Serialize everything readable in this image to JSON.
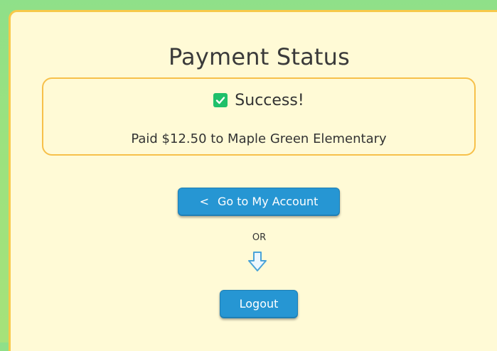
{
  "page": {
    "title": "Payment Status"
  },
  "status": {
    "headline": "Success!",
    "detail": "Paid $12.50 to Maple Green Elementary",
    "icon": "checkbox-check-icon",
    "color": "#1fc06a"
  },
  "actions": {
    "account_chevron": "<",
    "account_label": "Go to My Account",
    "or_text": "OR",
    "arrow_icon": "arrow-down-icon",
    "logout_label": "Logout"
  },
  "colors": {
    "background": "#fffad6",
    "border": "#f7c04a",
    "button": "#2696d3",
    "outer": "#9be27f"
  }
}
